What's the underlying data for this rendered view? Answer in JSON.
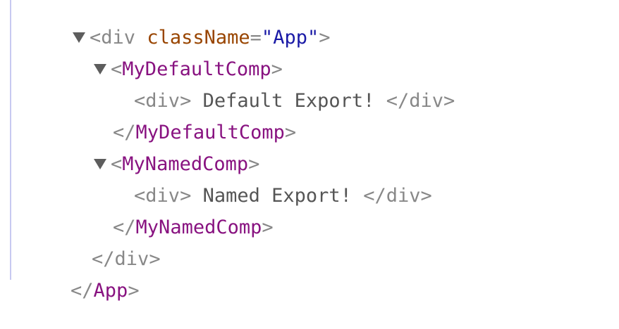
{
  "tree": {
    "app_open": {
      "tag": "div",
      "attr_name": "className",
      "attr_value": "App"
    },
    "default_comp": {
      "open_name": "MyDefaultComp",
      "child_open_tag": "div",
      "child_text": "Default Export!",
      "child_close_tag": "div",
      "close_name": "MyDefaultComp"
    },
    "named_comp": {
      "open_name": "MyNamedComp",
      "child_open_tag": "div",
      "child_text": "Named Export!",
      "child_close_tag": "div",
      "close_name": "MyNamedComp"
    },
    "app_div_close": {
      "tag": "div"
    },
    "app_root_close": {
      "name": "App"
    }
  },
  "colors": {
    "component": "#881280",
    "attribute_name": "#994500",
    "attribute_value": "#1a1aa6",
    "punctuation": "#888888",
    "text": "#555555",
    "border": "#c7c9f1"
  },
  "icons": {
    "expand": "triangle-down-icon"
  }
}
